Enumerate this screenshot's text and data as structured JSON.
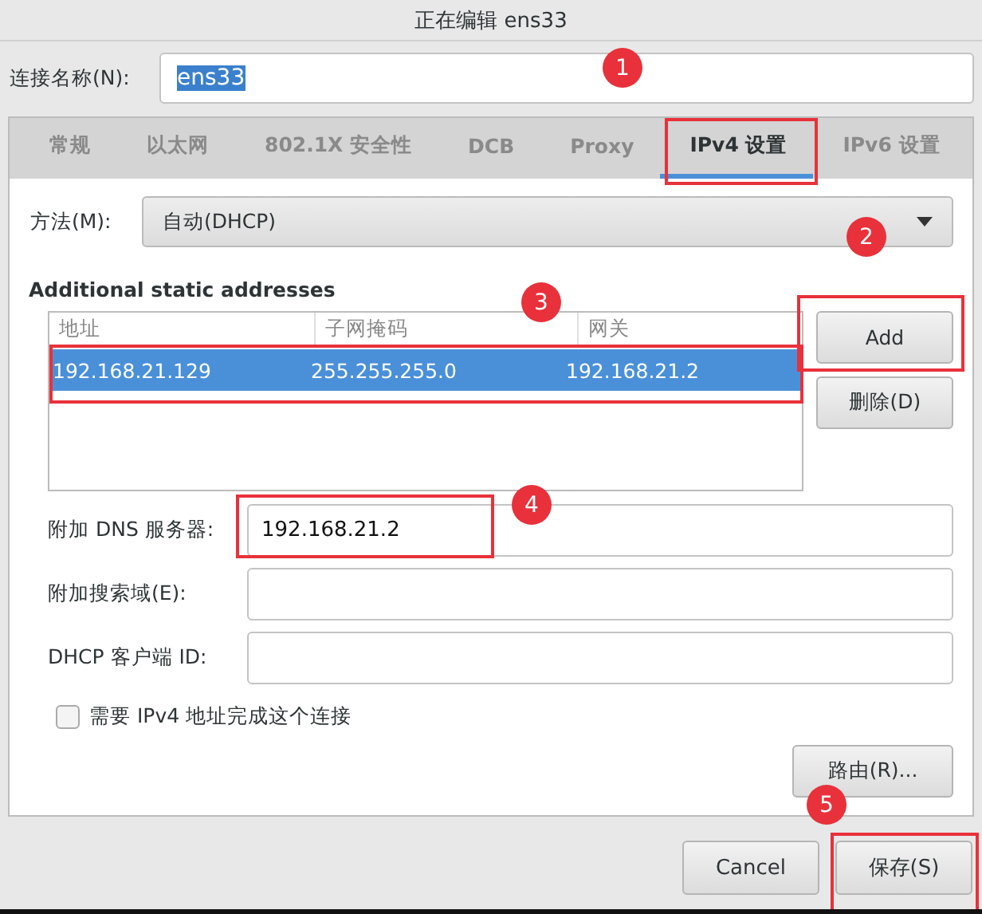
{
  "window": {
    "title": "正在编辑 ens33"
  },
  "connection_name": {
    "label": "连接名称(N):",
    "value": "ens33",
    "text_selected": true
  },
  "tabs": [
    {
      "label": "常规",
      "selected": false
    },
    {
      "label": "以太网",
      "selected": false
    },
    {
      "label": "802.1X 安全性",
      "selected": false
    },
    {
      "label": "DCB",
      "selected": false
    },
    {
      "label": "Proxy",
      "selected": false
    },
    {
      "label": "IPv4 设置",
      "selected": true
    },
    {
      "label": "IPv6 设置",
      "selected": false
    }
  ],
  "method": {
    "label": "方法(M):",
    "value": "自动(DHCP)"
  },
  "addresses": {
    "title": "Additional static addresses",
    "columns": [
      "地址",
      "子网掩码",
      "网关"
    ],
    "rows": [
      {
        "cells": [
          "192.168.21.129",
          "255.255.255.0",
          "192.168.21.2"
        ],
        "selected": true
      }
    ],
    "buttons": [
      "Add",
      "删除(D)"
    ]
  },
  "fields": [
    {
      "label": "附加 DNS 服务器:",
      "value": "192.168.21.2"
    },
    {
      "label": "附加搜索域(E):"
    },
    {
      "label": "DHCP 客户端 ID:"
    }
  ],
  "require_ipv4": {
    "label": "需要 IPv4 地址完成这个连接",
    "checked": false
  },
  "routes_button": "路由(R)...",
  "footer_buttons": [
    "Cancel",
    "保存(S)"
  ],
  "annotations": [
    "1",
    "2",
    "3",
    "4",
    "5"
  ]
}
